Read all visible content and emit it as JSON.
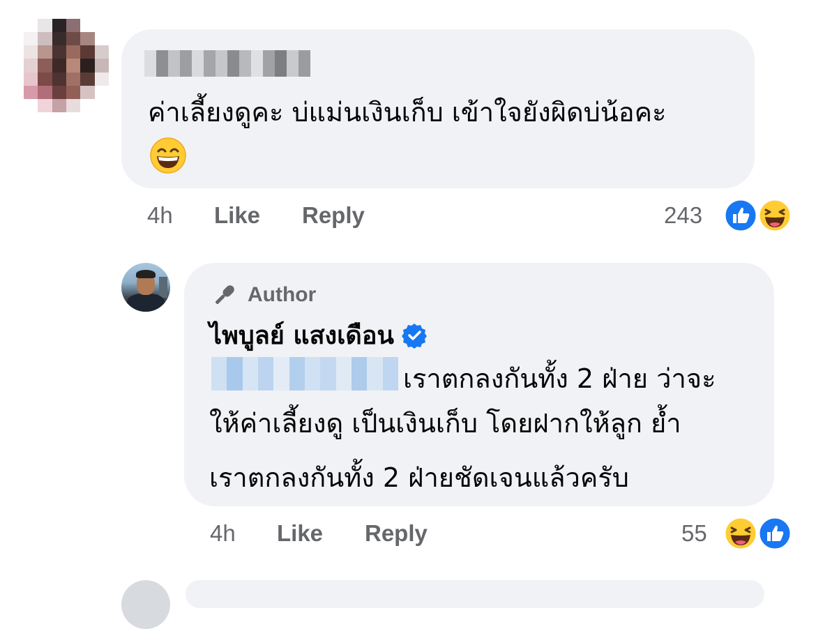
{
  "comment1": {
    "author_name_blurred": true,
    "text": "ค่าเลี้ยงดูคะ บ่แม่นเงินเก็บ เข้าใจยังผิดบ่น้อคะ",
    "emoji": "grinning-face-with-smiling-eyes",
    "time": "4h",
    "like_label": "Like",
    "reply_label": "Reply",
    "reaction_count": "243",
    "reactions": [
      "like",
      "haha"
    ]
  },
  "reply1": {
    "badge_label": "Author",
    "author_name": "ไพบูลย์ แสงเดือน",
    "verified": true,
    "mention_blurred": true,
    "text_line1": "เราตกลงกันทั้ง 2 ฝ่าย ว่าจะ",
    "text_line2": "ให้ค่าเลี้ยงดู เป็นเงินเก็บ โดยฝากให้ลูก ย้ำ",
    "text_line3": "เราตกลงกันทั้ง 2 ฝ่ายชัดเจนแล้วครับ",
    "time": "4h",
    "like_label": "Like",
    "reply_label": "Reply",
    "reaction_count": "55",
    "reactions": [
      "haha",
      "like"
    ]
  },
  "colors": {
    "bubble": "#f0f2f5",
    "meta_text": "#65676b",
    "like_blue": "#1877f2",
    "text": "#050505"
  }
}
